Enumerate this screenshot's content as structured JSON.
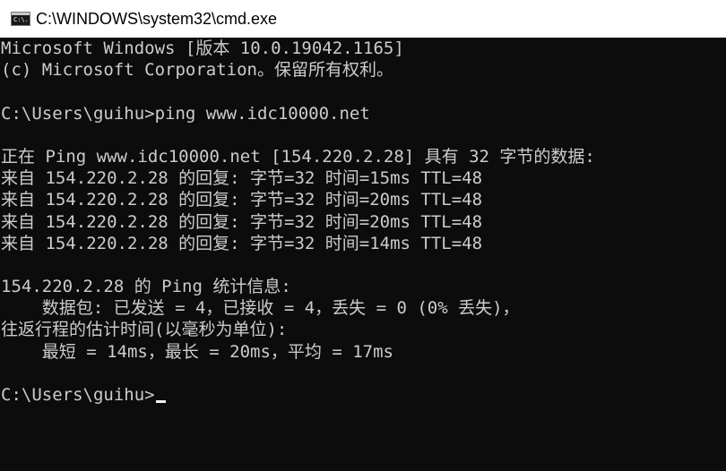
{
  "window": {
    "title": "C:\\WINDOWS\\system32\\cmd.exe",
    "icon": "cmd-console-icon",
    "icon_glyph": "C:\\."
  },
  "console": {
    "lines": [
      "Microsoft Windows [版本 10.0.19042.1165]",
      "(c) Microsoft Corporation。保留所有权利。",
      "",
      "C:\\Users\\guihu>ping www.idc10000.net",
      "",
      "正在 Ping www.idc10000.net [154.220.2.28] 具有 32 字节的数据:",
      "来自 154.220.2.28 的回复: 字节=32 时间=15ms TTL=48",
      "来自 154.220.2.28 的回复: 字节=32 时间=20ms TTL=48",
      "来自 154.220.2.28 的回复: 字节=32 时间=20ms TTL=48",
      "来自 154.220.2.28 的回复: 字节=32 时间=14ms TTL=48",
      "",
      "154.220.2.28 的 Ping 统计信息:",
      "    数据包: 已发送 = 4，已接收 = 4，丢失 = 0 (0% 丢失)，",
      "往返行程的估计时间(以毫秒为单位):",
      "    最短 = 14ms，最长 = 20ms，平均 = 17ms",
      "",
      "C:\\Users\\guihu>"
    ]
  },
  "colors": {
    "console_background": "#0c0c0c",
    "console_text": "#cccccc",
    "titlebar_background": "#ffffff"
  }
}
